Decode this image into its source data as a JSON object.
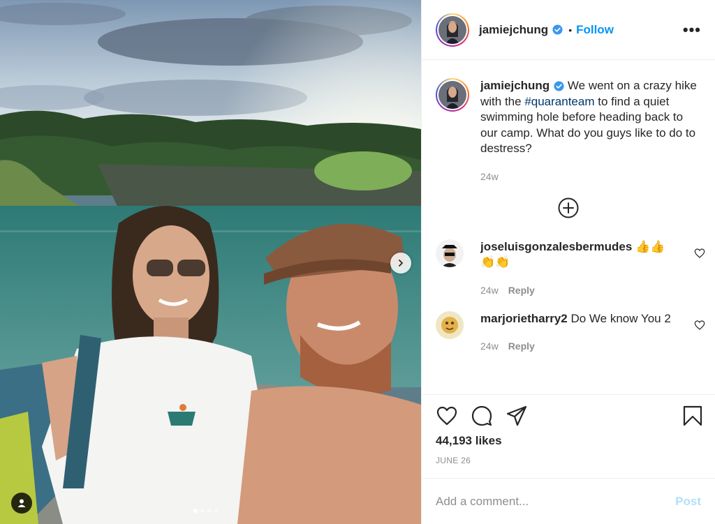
{
  "header": {
    "username": "jamiejchung",
    "separator": "•",
    "follow_label": "Follow",
    "more_label": "•••"
  },
  "caption": {
    "username": "jamiejchung",
    "text_before": " We went on a crazy hike with the ",
    "hashtag": "#quaranteam",
    "text_after": " to find a quiet swimming hole before heading back to our camp. What do you guys like to do to destress?",
    "time": "24w"
  },
  "comments": [
    {
      "username": "joseluisgonzalesbermudes",
      "text": " 👍👍 👏👏",
      "time": "24w",
      "reply_label": "Reply"
    },
    {
      "username": "marjorietharry2",
      "text": " Do We know You 2",
      "time": "24w",
      "reply_label": "Reply"
    }
  ],
  "post": {
    "likes": "44,193 likes",
    "date": "JUNE 26"
  },
  "composer": {
    "placeholder": "Add a comment...",
    "post_label": "Post"
  },
  "carousel": {
    "total_slides": 4,
    "active_slide": 1
  },
  "colors": {
    "accent": "#0095f6",
    "hashtag": "#00376b",
    "muted": "#8e8e8e",
    "post_disabled": "#b2dffc",
    "verified": "#3897f0"
  }
}
